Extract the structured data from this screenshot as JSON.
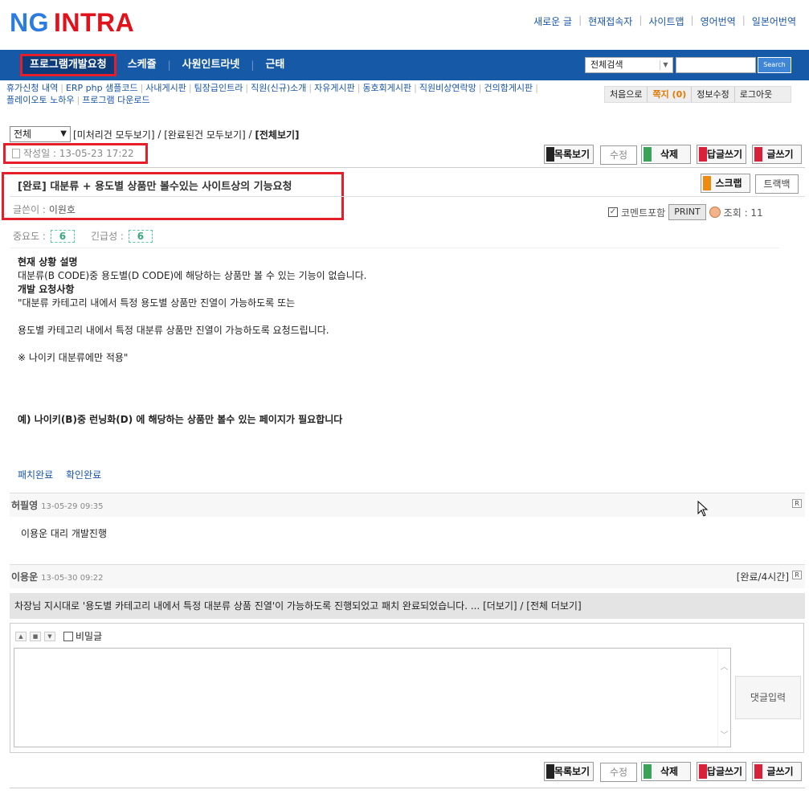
{
  "logo": {
    "ng": "NG",
    "intra": "INTRA"
  },
  "top_links": [
    "새로운 글",
    "현재접속자",
    "사이트맵",
    "영어번역",
    "일본어번역"
  ],
  "nav": {
    "items": [
      "프로그램개발요청",
      "스케쥴",
      "사원인트라넷",
      "근태"
    ],
    "active": 0
  },
  "search": {
    "scope": "전체검색",
    "button": "Search"
  },
  "submenu": [
    "휴가신청 내역",
    "ERP php 샘플코드",
    "사내게시판",
    "팀장급인트라",
    "직원(신규)소개",
    "자유게시판",
    "동호회게시판",
    "직원비상연락망",
    "건의함게시판",
    "플레이오토 노하우",
    "프로그램 다운로드"
  ],
  "userbox": {
    "home": "처음으로",
    "note": "쪽지 (0)",
    "edit": "정보수정",
    "logout": "로그아웃"
  },
  "filter": {
    "select": "전체",
    "link1": "[미처리건 모두보기]",
    "sep1": "/",
    "link2": "[완료된건 모두보기]",
    "sep2": "/",
    "current": "[전체보기]"
  },
  "post": {
    "date": "작성일 : 13-05-23 17:22",
    "title": "[완료] 대분류 + 용도별 상품만 볼수있는 사이트상의 기능요청",
    "writer_label": "글쓴이 :",
    "writer": "이원호",
    "comment_include": "코멘트포함",
    "print": "PRINT",
    "views": "조회 : 11",
    "importance_label": "중요도 :",
    "importance": "6",
    "urgency_label": "긴급성 :",
    "urgency": "6",
    "body": {
      "h1": "현재 상황 설명",
      "p1": "대분류(B CODE)중 용도별(D CODE)에 해당하는 상품만 볼 수 있는 기능이 없습니다.",
      "h2": "개발 요청사항",
      "p2": "\"대분류 카테고리 내에서 특정 용도별 상품만 진열이 가능하도록 또는",
      "p3": "용도별 카테고리 내에서 특정 대분류 상품만 진열이 가능하도록 요청드립니다.",
      "p4": "※ 나이키 대분류에만 적용\"",
      "p5": "예) 나이키(B)중 런닝화(D) 에 해당하는 상품만 볼수 있는 페이지가 필요합니다"
    },
    "status_links": [
      "패치완료",
      "확인완료"
    ]
  },
  "buttons": {
    "list": "목록보기",
    "edit": "수정",
    "delete": "삭제",
    "reply": "답글쓰기",
    "write": "글쓰기",
    "scrap": "스크랩",
    "trackback": "트랙백"
  },
  "comments": [
    {
      "name": "허필영",
      "time": "13-05-29 09:35",
      "text": "이용운 대리 개발진행",
      "badge": "R"
    },
    {
      "name": "이용운",
      "time": "13-05-30 09:22",
      "status": "[완료/4시간]",
      "text": "차장님 지시대로 '용도별 카테고리 내에서 특정 대분류 상품 진열'이 가능하도록 진행되었고 패치 완료되었습니다. ... [더보기] / [전체 더보기]",
      "badge": "R"
    }
  ],
  "editor": {
    "secret": "비밀글",
    "submit": "댓글입력",
    "check": "✓"
  }
}
